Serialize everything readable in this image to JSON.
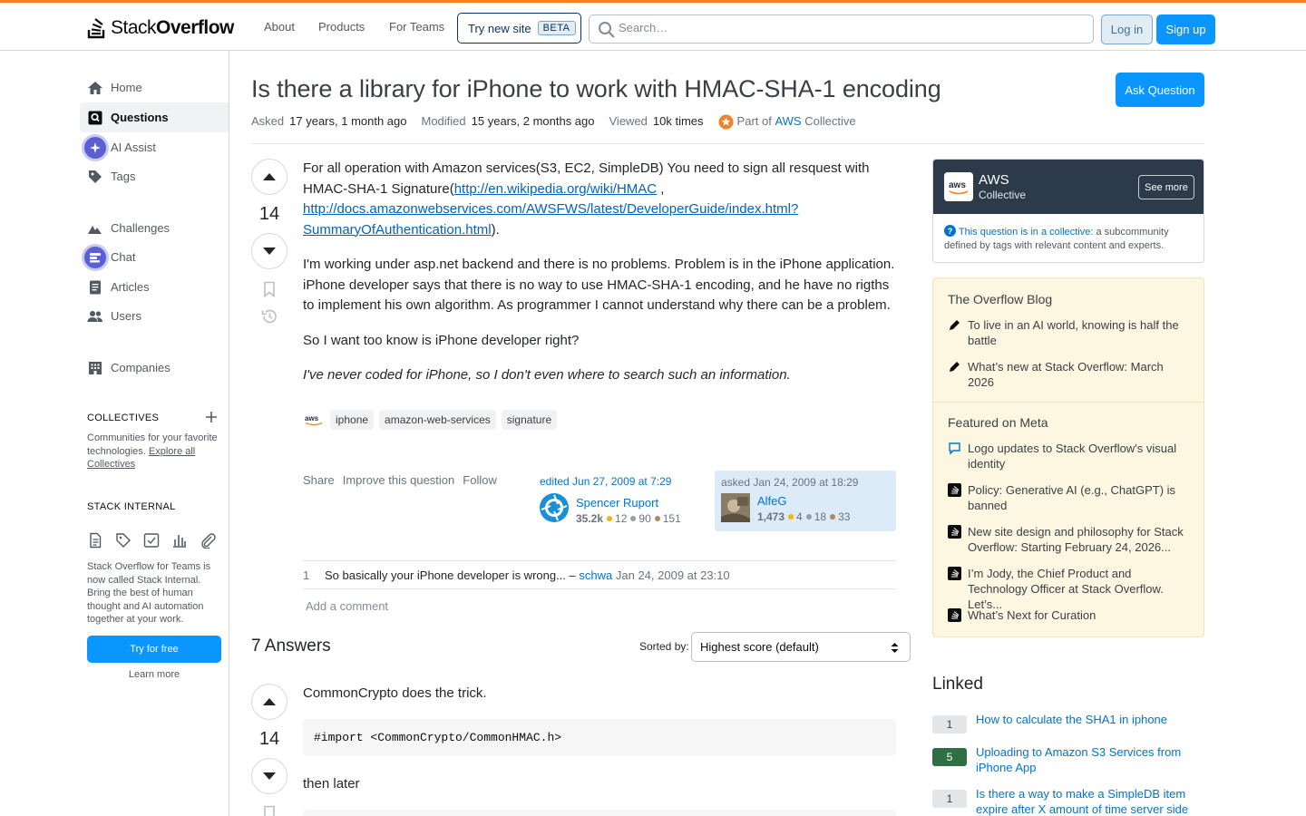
{
  "topbar": {
    "logo_stack": "Stack",
    "logo_overflow": "Overflow",
    "nav": [
      "About",
      "Products",
      "For Teams"
    ],
    "try_new_site": "Try new site",
    "beta": "BETA",
    "search_placeholder": "Search…",
    "login": "Log in",
    "signup": "Sign up"
  },
  "sidebar": {
    "items": [
      {
        "label": "Home",
        "icon": "home-icon"
      },
      {
        "label": "Questions",
        "icon": "questions-icon"
      },
      {
        "label": "AI Assist",
        "icon": "ai-assist-icon"
      },
      {
        "label": "Tags",
        "icon": "tag-icon"
      },
      {
        "label": "Challenges",
        "icon": "challenges-icon"
      },
      {
        "label": "Chat",
        "icon": "chat-icon"
      },
      {
        "label": "Articles",
        "icon": "articles-icon"
      },
      {
        "label": "Users",
        "icon": "users-icon"
      },
      {
        "label": "Companies",
        "icon": "companies-icon"
      }
    ],
    "collectives_heading": "COLLECTIVES",
    "collectives_text": "Communities for your favorite technologies.",
    "collectives_link": "Explore all Collectives",
    "stack_internal_heading": "STACK INTERNAL",
    "stack_internal_text": "Stack Overflow for Teams is now called Stack Internal. Bring the best of human thought and AI automation together at your work.",
    "try_free": "Try for free",
    "learn_more": "Learn more"
  },
  "question": {
    "title": "Is there a library for iPhone to work with HMAC-SHA-1 encoding",
    "ask_button": "Ask Question",
    "asked_label": "Asked",
    "asked_value": "17 years, 1 month ago",
    "modified_label": "Modified",
    "modified_value": "15 years, 2 months ago",
    "viewed_label": "Viewed",
    "viewed_value": "10k times",
    "collective_prefix": "Part of",
    "collective_name": "AWS",
    "collective_suffix": "Collective",
    "score": "14",
    "body_p1_a": "For all operation with Amazon services(S3, EC2, SimpleDB) You need to sign all resquest with HMAC-SHA-1 Signature(",
    "body_link1": "http://en.wikipedia.org/wiki/HMAC",
    "body_p1_b": " , ",
    "body_link2": "http://docs.amazonwebservices.com/AWSFWS/latest/DeveloperGuide/index.html?SummaryOfAuthentication.html",
    "body_p1_c": ").",
    "body_p2": "I'm working under asp.net backend and there is no problems. Problem is in the iPhone application. iPhone developer says that there is no way to use HMAC-SHA-1 encoding, and he have no rigths to implement his own algorithm. As programmer I cannot understand why there can be a problem.",
    "body_p3": "So I want too know is iPhone developer right?",
    "body_p4": "I've never coded for iPhone, so I don't even where to search such an information.",
    "tags": [
      "iphone",
      "amazon-web-services",
      "signature"
    ],
    "menu": [
      "Share",
      "Improve this question",
      "Follow"
    ],
    "edited": {
      "when": "edited Jun 27, 2009 at 7:29",
      "user": "Spencer Ruport",
      "rep": "35.2k",
      "gold": "12",
      "silver": "90",
      "bronze": "151"
    },
    "asked": {
      "when": "asked Jan 24, 2009 at 18:29",
      "user": "AlfeG",
      "rep": "1,473",
      "gold": "4",
      "silver": "18",
      "bronze": "33"
    },
    "comment": {
      "score": "1",
      "text": "So basically your iPhone developer is wrong... –",
      "user": "schwa",
      "date": "Jan 24, 2009 at 23:10"
    },
    "add_comment": "Add a comment"
  },
  "answers": {
    "heading": "7 Answers",
    "sorted_by": "Sorted by:",
    "sort_value": "Highest score (default)",
    "first": {
      "score": "14",
      "text1": "CommonCrypto does the trick.",
      "code1": "#import <CommonCrypto/CommonHMAC.h>",
      "text2": "then later"
    }
  },
  "right": {
    "collective": {
      "name": "AWS",
      "sub": "Collective",
      "see_more": "See more",
      "note_link": "This question is in a collective:",
      "note_text": " a subcommunity defined by tags with relevant content and experts."
    },
    "blog_heading": "The Overflow Blog",
    "blog_items": [
      "To live in an AI world, knowing is half the battle",
      "What’s new at Stack Overflow: March 2026"
    ],
    "meta_heading": "Featured on Meta",
    "meta_items": [
      "Logo updates to Stack Overflow's visual identity",
      "Policy: Generative AI (e.g., ChatGPT) is banned",
      "New site design and philosophy for Stack Overflow: Starting February 24, 2026...",
      "I’m Jody, the Chief Product and Technology Officer at Stack Overflow. Let’s...",
      "What’s Next for Curation"
    ],
    "linked_heading": "Linked",
    "linked": [
      {
        "score": "1",
        "title": "How to calculate the SHA1 in iphone",
        "accepted": false
      },
      {
        "score": "5",
        "title": "Uploading to Amazon S3 Services from iPhone App",
        "accepted": true
      },
      {
        "score": "1",
        "title": "Is there a way to make a SimpleDB item expire after X amount of time server side",
        "accepted": false
      }
    ]
  },
  "colors": {
    "brand_orange": "#f48225",
    "primary_blue": "#0a95ff",
    "accepted_green": "#2f6f44"
  }
}
